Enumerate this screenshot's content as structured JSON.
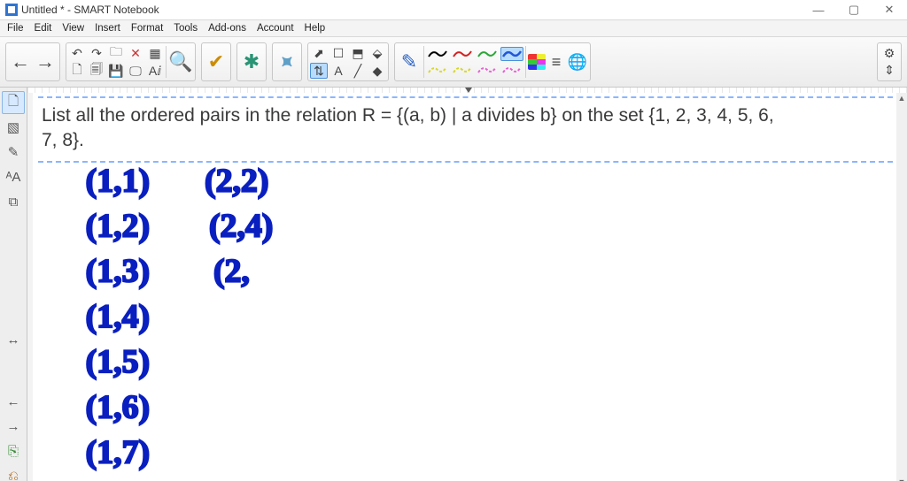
{
  "window": {
    "title": "Untitled * - SMART Notebook"
  },
  "menu": {
    "items": [
      "File",
      "Edit",
      "View",
      "Insert",
      "Format",
      "Tools",
      "Add-ons",
      "Account",
      "Help"
    ]
  },
  "toolbar": {
    "nav": {
      "back": "←",
      "forward": "→"
    },
    "group1_icons": [
      "↶",
      "↷",
      "🗀",
      "✕",
      "▦",
      "🗋",
      "🗐",
      "💾",
      "🖵",
      "Aⅈ"
    ],
    "zoom_icon": "🔍",
    "check_icon": "✔",
    "addon_icon": "✱",
    "puzzle_icon": "⯍",
    "group_select": {
      "icons": [
        "⬈",
        "☐",
        "⬒",
        "⬙",
        "⇅",
        "A",
        "╱",
        "◆"
      ],
      "selected_index": 4
    },
    "pen_icon": "✎",
    "pen_colors_top": [
      "#000000",
      "#d42222",
      "#2aa836",
      "#2356d6"
    ],
    "pen_colors_bottom": [
      "#d8d82e",
      "#d6d628",
      "#e85fd2",
      "#e85fd2"
    ],
    "pen_selected_index": 3,
    "more_icons": {
      "colors": "colors",
      "align": "≡",
      "globe": "🌐"
    },
    "right_icons": {
      "gear": "⚙",
      "expand": "⇕"
    }
  },
  "side_tools": {
    "top": [
      "🗋",
      "▧",
      "✎",
      "ᴬA",
      "⧉"
    ],
    "bottom": [
      "↔",
      "←",
      "→",
      "⎘",
      "⎌"
    ]
  },
  "problem": {
    "line1": "List all the ordered pairs in the relation R = {(a, b) | a divides b} on the set {1, 2, 3, 4, 5, 6,",
    "line2": "7, 8}."
  },
  "ink": {
    "col1": [
      "(1,1)",
      "(1,2)",
      "(1,3)",
      "(1,4)",
      "(1,5)",
      "(1,6)",
      "(1,7)"
    ],
    "col2": [
      "(2,2)",
      "(2,4)",
      "(2,"
    ]
  }
}
